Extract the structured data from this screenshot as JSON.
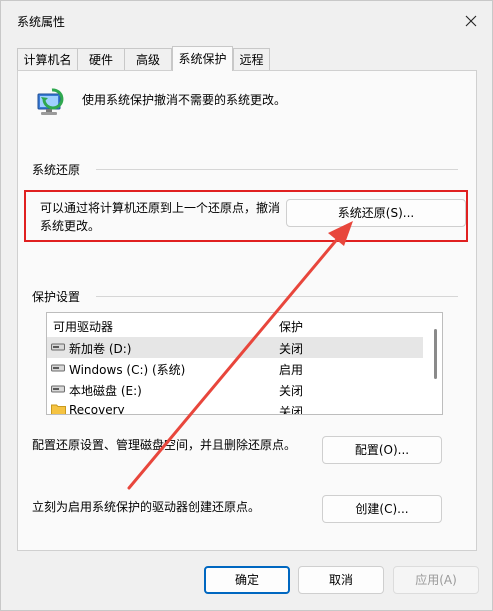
{
  "window": {
    "title": "系统属性"
  },
  "tabs": [
    {
      "label": "计算机名"
    },
    {
      "label": "硬件"
    },
    {
      "label": "高级"
    },
    {
      "label": "系统保护",
      "active": true
    },
    {
      "label": "远程"
    }
  ],
  "header": {
    "text": "使用系统保护撤消不需要的系统更改。"
  },
  "restore_section": {
    "title": "系统还原",
    "description_line1": "可以通过将计算机还原到上一个还原点，撤消",
    "description_line2": "系统更改。",
    "button_label": "系统还原(S)..."
  },
  "protection_section": {
    "title": "保护设置",
    "columns": [
      "可用驱动器",
      "保护"
    ],
    "drives": [
      {
        "name": "新加卷 (D:)",
        "protection": "关闭",
        "icon": "drive-icon",
        "selected": true
      },
      {
        "name": "Windows (C:) (系统)",
        "protection": "启用",
        "icon": "drive-icon"
      },
      {
        "name": "本地磁盘 (E:)",
        "protection": "关闭",
        "icon": "drive-icon"
      },
      {
        "name": "Recovery",
        "protection": "关闭",
        "icon": "folder-icon"
      }
    ]
  },
  "configure": {
    "text": "配置还原设置、管理磁盘空间，并且删除还原点。",
    "button_label": "配置(O)..."
  },
  "create": {
    "text": "立刻为启用系统保护的驱动器创建还原点。",
    "button_label": "创建(C)..."
  },
  "footer": {
    "ok_label": "确定",
    "cancel_label": "取消",
    "apply_label": "应用(A)"
  },
  "colors": {
    "highlight_box": "#e02020",
    "arrow": "#e8463c",
    "primary_button_border": "#0067c0"
  }
}
